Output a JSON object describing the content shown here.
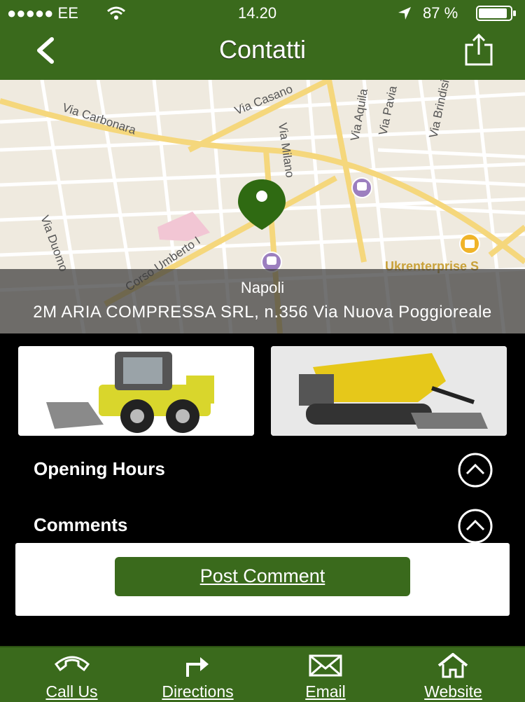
{
  "status_bar": {
    "signal": "●●●●● EE",
    "time": "14.20",
    "battery": "87 %"
  },
  "nav": {
    "title": "Contatti",
    "back_icon": "chevron-left-icon",
    "share_icon": "share-icon"
  },
  "map": {
    "streets": [
      "Via Carbonara",
      "Via Casano",
      "Via Aquila",
      "Via Pavia",
      "Via Brindisi",
      "Via Milano",
      "Via Duomo",
      "Corso Umberto I"
    ],
    "poi": "Ukrenterprise S",
    "city": "Napoli",
    "address": "2M ARIA COMPRESSA SRL, n.356 Via Nuova Poggioreale"
  },
  "photos": [
    "skid-steer-loader-photo",
    "tracked-dumper-photo"
  ],
  "sections": [
    {
      "label": "Opening Hours",
      "icon": "chevron-up-circle-icon"
    },
    {
      "label": "Comments",
      "icon": "chevron-up-circle-icon"
    }
  ],
  "comment": {
    "button_label": "Post Comment"
  },
  "tabs": [
    {
      "label": "Call Us",
      "icon": "phone-icon"
    },
    {
      "label": "Directions",
      "icon": "directions-arrow-icon"
    },
    {
      "label": "Email",
      "icon": "envelope-icon"
    },
    {
      "label": "Website",
      "icon": "home-icon"
    }
  ],
  "colors": {
    "brand_green": "#3a6a1c",
    "pin_green": "#2f6a12",
    "background": "#000000"
  }
}
